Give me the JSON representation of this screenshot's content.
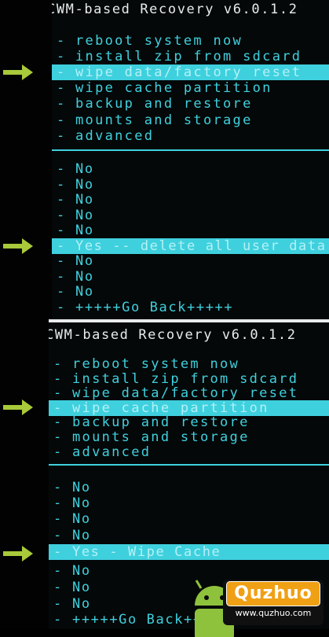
{
  "screen1": {
    "title": "CWM-based Recovery v6.0.1.2",
    "menu": [
      "reboot system now",
      "install zip from sdcard",
      "wipe data/factory reset",
      "wipe cache partition",
      "backup and restore",
      "mounts and storage",
      "advanced"
    ],
    "selected_menu_index": 2,
    "confirm": [
      "No",
      "No",
      "No",
      "No",
      "No",
      "Yes -- delete all user data",
      "No",
      "No",
      "No",
      "+++++Go Back+++++"
    ],
    "selected_confirm_index": 5
  },
  "screen2": {
    "title": "CWM-based Recovery v6.0.1.2",
    "menu": [
      "reboot system now",
      "install zip from sdcard",
      "wipe data/factory reset",
      "wipe cache partition",
      "backup and restore",
      "mounts and storage",
      "advanced"
    ],
    "selected_menu_index": 3,
    "confirm": [
      "No",
      "No",
      "No",
      "No",
      "Yes - Wipe Cache",
      "No",
      "No",
      "No",
      "+++++Go Back+++++"
    ],
    "selected_confirm_index": 4
  },
  "watermark": {
    "brand": "Quzhuo",
    "url": "www.quzhuo.com"
  },
  "colors": {
    "accent": "#3fd0de",
    "arrow": "#a8c93a",
    "background": "#050808"
  },
  "icons": [
    "arrow-right-icon",
    "android-robot-icon"
  ]
}
